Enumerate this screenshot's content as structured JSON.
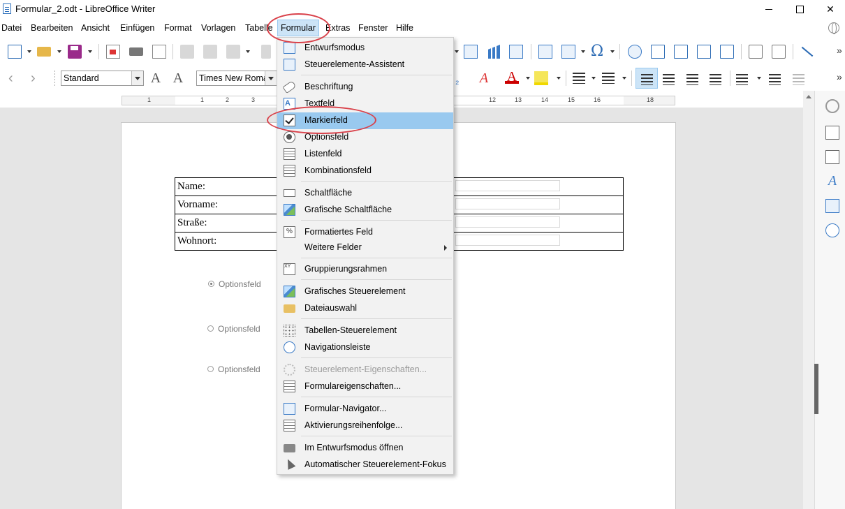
{
  "window": {
    "title": "Formular_2.odt - LibreOffice Writer",
    "minimize": "—",
    "maximize": "☐",
    "close": "✕"
  },
  "menubar": {
    "items": [
      {
        "label": "Datei"
      },
      {
        "label": "Bearbeiten"
      },
      {
        "label": "Ansicht"
      },
      {
        "label": "Einfügen"
      },
      {
        "label": "Format"
      },
      {
        "label": "Vorlagen"
      },
      {
        "label": "Tabelle"
      },
      {
        "label": "Formular",
        "active": true
      },
      {
        "label": "Extras"
      },
      {
        "label": "Fenster"
      },
      {
        "label": "Hilfe"
      }
    ]
  },
  "formatting": {
    "paragraph_style": "Standard",
    "font_name": "Times New Roman"
  },
  "ruler": {
    "numbers": [
      "1",
      "1",
      "2",
      "3",
      "12",
      "13",
      "14",
      "15",
      "16",
      "18"
    ]
  },
  "document": {
    "table_rows": [
      {
        "label": "Name:"
      },
      {
        "label": "Vorname:"
      },
      {
        "label": "Straße:"
      },
      {
        "label": "Wohnort:"
      }
    ],
    "radio_options": [
      {
        "label": "Optionsfeld",
        "checked": true
      },
      {
        "label": "Optionsfeld",
        "checked": false
      },
      {
        "label": "Optionsfeld",
        "checked": false
      }
    ]
  },
  "formular_menu": {
    "items": [
      {
        "label": "Entwurfsmodus",
        "icon": "design-mode-icon",
        "disabled": false
      },
      {
        "label": "Steuerelemente-Assistent",
        "icon": "wizard-icon",
        "disabled": false
      },
      {
        "label": "Beschriftung",
        "icon": "label-tag-icon",
        "disabled": false
      },
      {
        "label": "Textfeld",
        "icon": "text-field-icon",
        "disabled": false
      },
      {
        "label": "Markierfeld",
        "icon": "checkbox-icon",
        "disabled": false,
        "highlighted": true
      },
      {
        "label": "Optionsfeld",
        "icon": "radio-button-icon",
        "disabled": false
      },
      {
        "label": "Listenfeld",
        "icon": "list-box-icon",
        "disabled": false
      },
      {
        "label": "Kombinationsfeld",
        "icon": "combo-box-icon",
        "disabled": false
      },
      {
        "label": "Schaltfläche",
        "icon": "push-button-icon",
        "disabled": false
      },
      {
        "label": "Grafische Schaltfläche",
        "icon": "image-button-icon",
        "disabled": false
      },
      {
        "label": "Formatiertes Feld",
        "icon": "formatted-field-icon",
        "disabled": false
      },
      {
        "label": "Weitere Felder",
        "icon": "",
        "disabled": false,
        "submenu": true
      },
      {
        "label": "Gruppierungsrahmen",
        "icon": "group-box-icon",
        "disabled": false
      },
      {
        "label": "Grafisches Steuerelement",
        "icon": "image-control-icon",
        "disabled": false
      },
      {
        "label": "Dateiauswahl",
        "icon": "file-selection-icon",
        "disabled": false
      },
      {
        "label": "Tabellen-Steuerelement",
        "icon": "table-control-icon",
        "disabled": false
      },
      {
        "label": "Navigationsleiste",
        "icon": "navigation-bar-icon",
        "disabled": false
      },
      {
        "label": "Steuerelement-Eigenschaften...",
        "icon": "control-properties-icon",
        "disabled": true
      },
      {
        "label": "Formulareigenschaften...",
        "icon": "form-properties-icon",
        "disabled": false
      },
      {
        "label": "Formular-Navigator...",
        "icon": "form-navigator-icon",
        "disabled": false
      },
      {
        "label": "Aktivierungsreihenfolge...",
        "icon": "tab-order-icon",
        "disabled": false
      },
      {
        "label": "Im Entwurfsmodus öffnen",
        "icon": "open-design-mode-icon",
        "disabled": false
      },
      {
        "label": "Automatischer Steuerelement-Fokus",
        "icon": "auto-focus-icon",
        "disabled": false
      }
    ]
  },
  "colors": {
    "highlight": "#99c9ef",
    "active_menu": "#cce4f7",
    "callout": "#d9414a"
  }
}
